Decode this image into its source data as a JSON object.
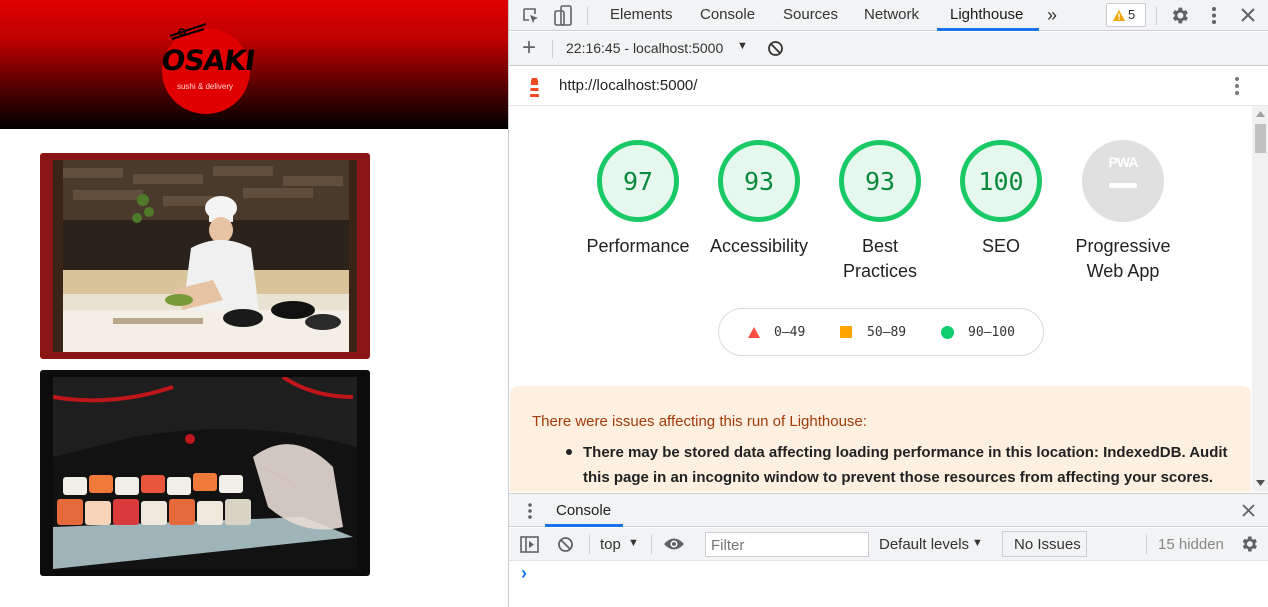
{
  "site": {
    "logo_text": "OSAKI",
    "logo_tagline": "sushi & delivery"
  },
  "devtools": {
    "tabs": [
      {
        "label": "Elements"
      },
      {
        "label": "Console"
      },
      {
        "label": "Sources"
      },
      {
        "label": "Network"
      },
      {
        "label": "Lighthouse"
      }
    ],
    "more_tabs": "»",
    "warning_count": "5",
    "toolbar": {
      "report_selector": "22:16:45 - localhost:5000",
      "add_label": "+"
    },
    "url": "http://localhost:5000/",
    "scores": [
      {
        "value": "97",
        "label": "Performance"
      },
      {
        "value": "93",
        "label": "Accessibility"
      },
      {
        "value": "93",
        "label": "Best Practices"
      },
      {
        "value": "100",
        "label": "SEO"
      }
    ],
    "pwa": {
      "label": "Progressive Web App",
      "badge": "PWA"
    },
    "legend": [
      {
        "range": "0–49",
        "color": "#ff4e42"
      },
      {
        "range": "50–89",
        "color": "#ffa400"
      },
      {
        "range": "90–100",
        "color": "#0cce6b"
      }
    ],
    "warning": {
      "title": "There were issues affecting this run of Lighthouse:",
      "item": "There may be stored data affecting loading performance in this location: IndexedDB. Audit this page in an incognito window to prevent those resources from affecting your scores."
    },
    "drawer": {
      "tab": "Console",
      "context": "top",
      "filter_placeholder": "Filter",
      "levels": "Default levels",
      "issues": "No Issues",
      "hidden": "15 hidden",
      "prompt": "›"
    },
    "colors": {
      "accent": "#1a73e8",
      "pass": "#0cce6b"
    }
  }
}
